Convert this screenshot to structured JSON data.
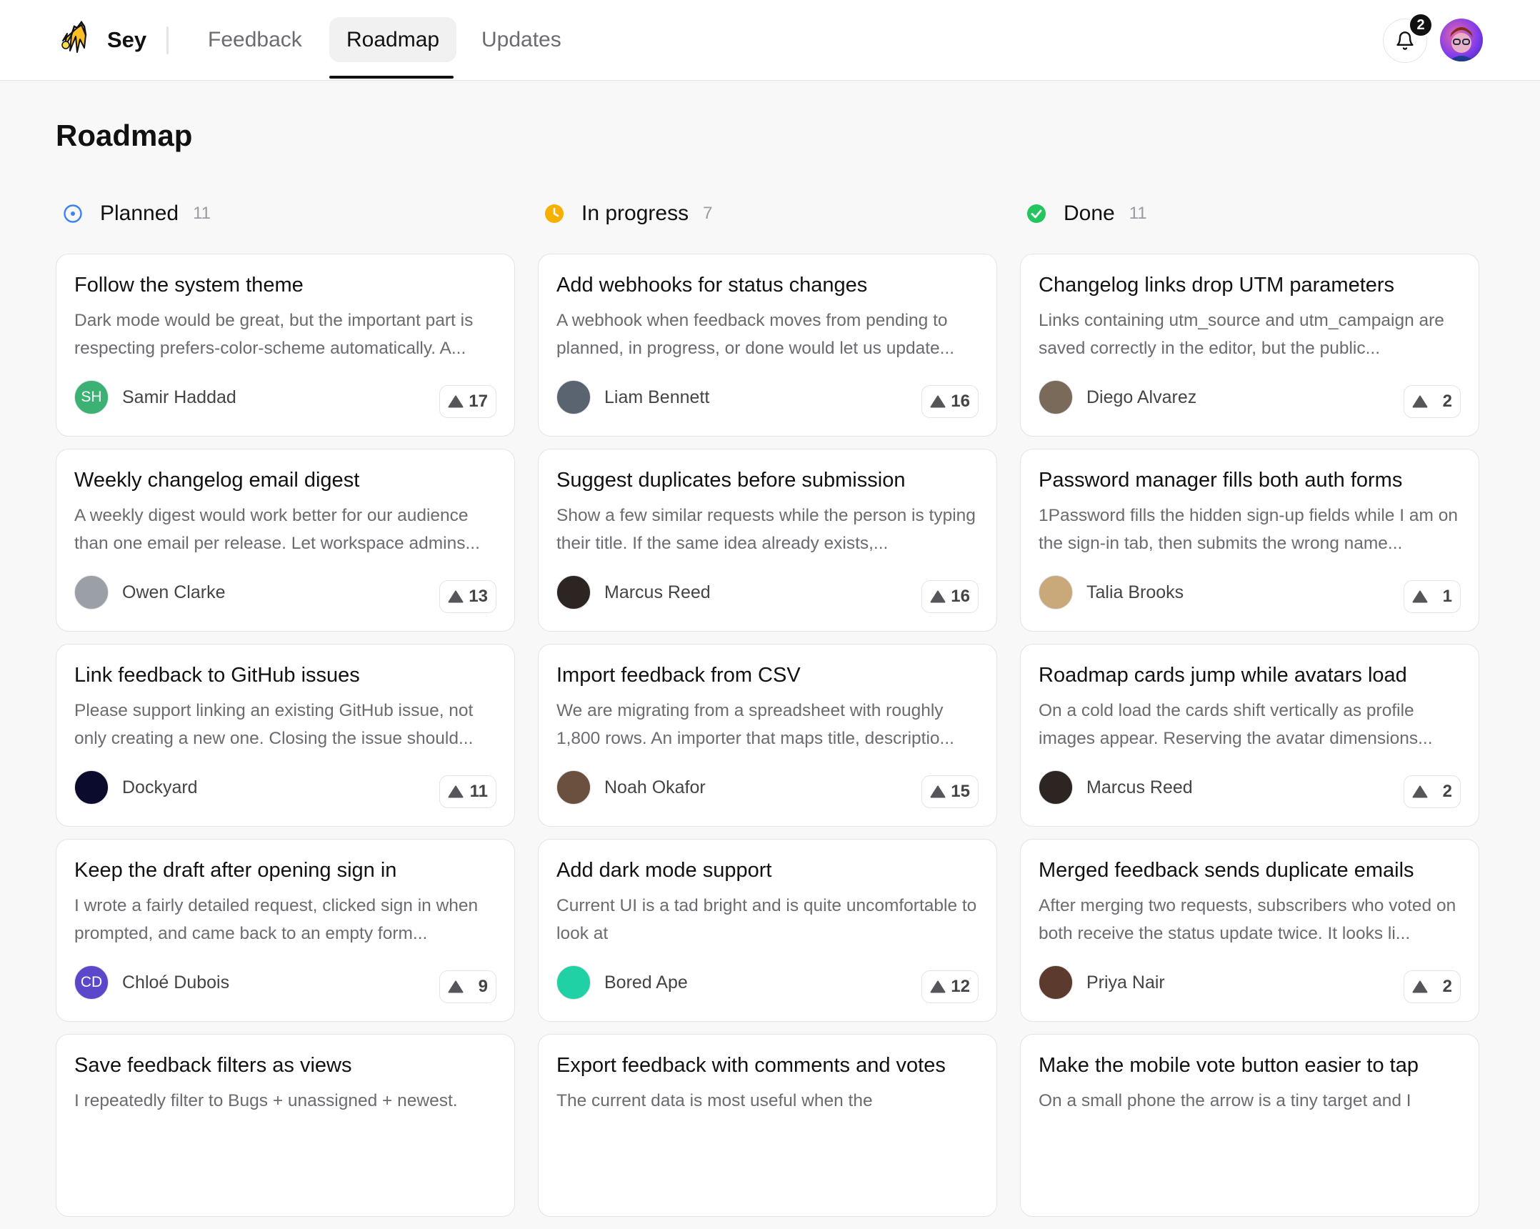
{
  "app": {
    "name": "Sey"
  },
  "nav": {
    "tabs": [
      {
        "label": "Feedback"
      },
      {
        "label": "Roadmap",
        "active": true
      },
      {
        "label": "Updates"
      }
    ]
  },
  "notifications": {
    "count": "2"
  },
  "page": {
    "title": "Roadmap"
  },
  "colors": {
    "planned": "#3b82f6",
    "in_progress": "#f5b000",
    "done": "#22c55e"
  },
  "columns": [
    {
      "title": "Planned",
      "count": "11",
      "status_icon": "dotted-circle-icon",
      "cards": [
        {
          "title": "Follow the system theme",
          "description": "Dark mode would be great, but the important part is respecting prefers-color-scheme automatically. A...",
          "author": "Samir Haddad",
          "avatar_initials": "SH",
          "avatar_color": "#3bb273",
          "votes": "17"
        },
        {
          "title": "Weekly changelog email digest",
          "description": "A weekly digest would work better for our audience than one email per release. Let workspace admins...",
          "author": "Owen Clarke",
          "avatar_initials": "",
          "avatar_color": "#9aa0a6",
          "votes": "13"
        },
        {
          "title": "Link feedback to GitHub issues",
          "description": "Please support linking an existing GitHub issue, not only creating a new one. Closing the issue should...",
          "author": "Dockyard",
          "avatar_initials": "",
          "avatar_color": "#0b0b2e",
          "votes": "11"
        },
        {
          "title": "Keep the draft after opening sign in",
          "description": "I wrote a fairly detailed request, clicked sign in when prompted, and came back to an empty form...",
          "author": "Chloé Dubois",
          "avatar_initials": "CD",
          "avatar_color": "#5b47c9",
          "votes": "9"
        },
        {
          "title": "Save feedback filters as views",
          "description": "I repeatedly filter to Bugs + unassigned + newest.",
          "author": "",
          "avatar_initials": "",
          "avatar_color": "#9aa0a6",
          "votes": ""
        }
      ]
    },
    {
      "title": "In progress",
      "count": "7",
      "status_icon": "clock-icon",
      "cards": [
        {
          "title": "Add webhooks for status changes",
          "description": "A webhook when feedback moves from pending to planned, in progress, or done would let us update...",
          "author": "Liam Bennett",
          "avatar_initials": "",
          "avatar_color": "#5a6470",
          "votes": "16"
        },
        {
          "title": "Suggest duplicates before submission",
          "description": "Show a few similar requests while the person is typing their title. If the same idea already exists,...",
          "author": "Marcus Reed",
          "avatar_initials": "",
          "avatar_color": "#2d2522",
          "votes": "16"
        },
        {
          "title": "Import feedback from CSV",
          "description": "We are migrating from a spreadsheet with roughly 1,800 rows. An importer that maps title, descriptio...",
          "author": "Noah Okafor",
          "avatar_initials": "",
          "avatar_color": "#6b4f3f",
          "votes": "15"
        },
        {
          "title": "Add dark mode support",
          "description": "Current UI is a tad bright and is quite uncomfortable to look at",
          "author": "Bored Ape",
          "avatar_initials": "",
          "avatar_color": "#1fd1a5",
          "votes": "12"
        },
        {
          "title": "Export feedback with comments and votes",
          "description": "The current data is most useful when the",
          "author": "",
          "avatar_initials": "",
          "avatar_color": "#9aa0a6",
          "votes": ""
        }
      ]
    },
    {
      "title": "Done",
      "count": "11",
      "status_icon": "check-circle-icon",
      "cards": [
        {
          "title": "Changelog links drop UTM parameters",
          "description": "Links containing utm_source and utm_campaign are saved correctly in the editor, but the public...",
          "author": "Diego Alvarez",
          "avatar_initials": "",
          "avatar_color": "#7a6a5a",
          "votes": "2"
        },
        {
          "title": "Password manager fills both auth forms",
          "description": "1Password fills the hidden sign-up fields while I am on the sign-in tab, then submits the wrong name...",
          "author": "Talia Brooks",
          "avatar_initials": "",
          "avatar_color": "#c9a87a",
          "votes": "1"
        },
        {
          "title": "Roadmap cards jump while avatars load",
          "description": "On a cold load the cards shift vertically as profile images appear. Reserving the avatar dimensions...",
          "author": "Marcus Reed",
          "avatar_initials": "",
          "avatar_color": "#2d2522",
          "votes": "2"
        },
        {
          "title": "Merged feedback sends duplicate emails",
          "description": "After merging two requests, subscribers who voted on both receive the status update twice. It looks li...",
          "author": "Priya Nair",
          "avatar_initials": "",
          "avatar_color": "#5c3a2e",
          "votes": "2"
        },
        {
          "title": "Make the mobile vote button easier to tap",
          "description": "On a small phone the arrow is a tiny target and I",
          "author": "",
          "avatar_initials": "",
          "avatar_color": "#9aa0a6",
          "votes": ""
        }
      ]
    }
  ]
}
